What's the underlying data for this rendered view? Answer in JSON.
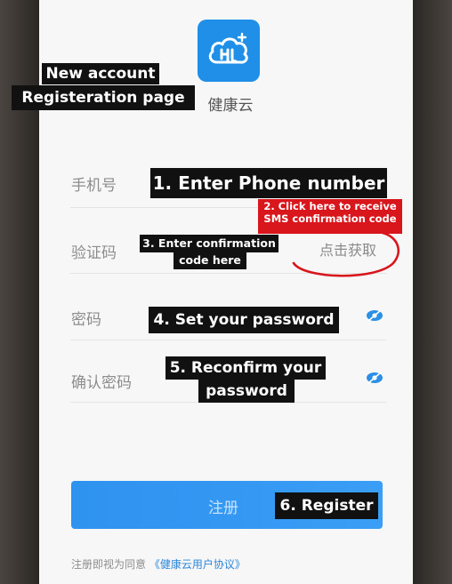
{
  "app": {
    "name": "健康云",
    "logo_icon": "cloud-person-icon",
    "brand_color": "#1f8fe8"
  },
  "form": {
    "phone_label": "手机号",
    "code_label": "验证码",
    "get_code_button": "点击获取",
    "password_label": "密码",
    "confirm_password_label": "确认密码",
    "eye_icon": "eye-icon"
  },
  "register": {
    "label": "注册",
    "button_color": "#3a9ef6"
  },
  "agreement": {
    "prefix": "注册即视为同意",
    "link": "《健康云用户协议》"
  },
  "annotations": {
    "title_line1": "New account",
    "title_line2": "Registeration page",
    "step1": "1. Enter Phone number",
    "step2_line1": "2. Click here to receive",
    "step2_line2": "SMS confirmation code",
    "step3_line1": "3. Enter confirmation",
    "step3_line2": "code here",
    "step4": "4. Set your password",
    "step5_line1": "5. Reconfirm your",
    "step5_line2": "password",
    "step6": "6. Register",
    "annotation_color": "#111111",
    "highlight_color": "#d8161c"
  }
}
